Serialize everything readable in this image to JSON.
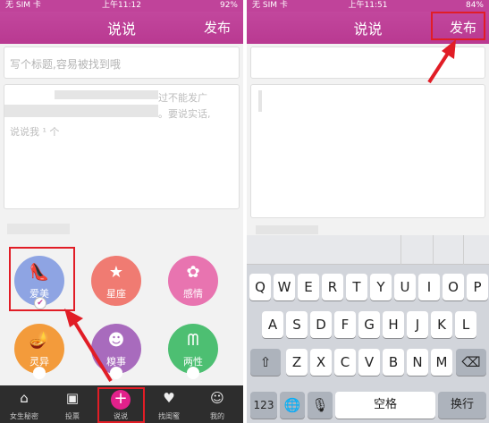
{
  "left": {
    "status": {
      "carrier": "无 SIM 卡",
      "time": "上午11:12",
      "battery": "92%"
    },
    "nav": {
      "title": "说说",
      "publish": "发布"
    },
    "title_placeholder": "写个标题,容易被找到哦",
    "content_fragments": {
      "a": "过不能发广",
      "b": "。要说实话,",
      "c": "说说我 ¹ 个"
    },
    "categories": [
      {
        "label": "爱美",
        "icon": "high-heel-icon",
        "color": "#8ea4e3"
      },
      {
        "label": "星座",
        "icon": "star-icon",
        "color": "#f07b72"
      },
      {
        "label": "感情",
        "icon": "clover-icon",
        "color": "#e874b0"
      },
      {
        "label": "灵异",
        "icon": "lamp-icon",
        "color": "#f39b3b"
      },
      {
        "label": "糗事",
        "icon": "mask-icon",
        "color": "#a86bbd"
      },
      {
        "label": "两性",
        "icon": "bra-icon",
        "color": "#4dbf72"
      }
    ],
    "tabs": [
      {
        "label": "女生秘密",
        "icon": "house-icon"
      },
      {
        "label": "投票",
        "icon": "vote-icon"
      },
      {
        "label": "说说",
        "icon": "plus-icon"
      },
      {
        "label": "找闺蜜",
        "icon": "find-friend-icon"
      },
      {
        "label": "我的",
        "icon": "profile-icon"
      }
    ],
    "annotation_color": "#e11d26"
  },
  "right": {
    "status": {
      "carrier": "无 SIM 卡",
      "time": "上午11:51",
      "battery": "84%"
    },
    "nav": {
      "title": "说说",
      "publish": "发布"
    },
    "keyboard": {
      "row1": [
        "Q",
        "W",
        "E",
        "R",
        "T",
        "Y",
        "U",
        "I",
        "O",
        "P"
      ],
      "row2": [
        "A",
        "S",
        "D",
        "F",
        "G",
        "H",
        "J",
        "K",
        "L"
      ],
      "row3": [
        "Z",
        "X",
        "C",
        "V",
        "B",
        "N",
        "M"
      ],
      "row4": {
        "num": "123",
        "space": "空格",
        "return": "换行"
      }
    }
  }
}
